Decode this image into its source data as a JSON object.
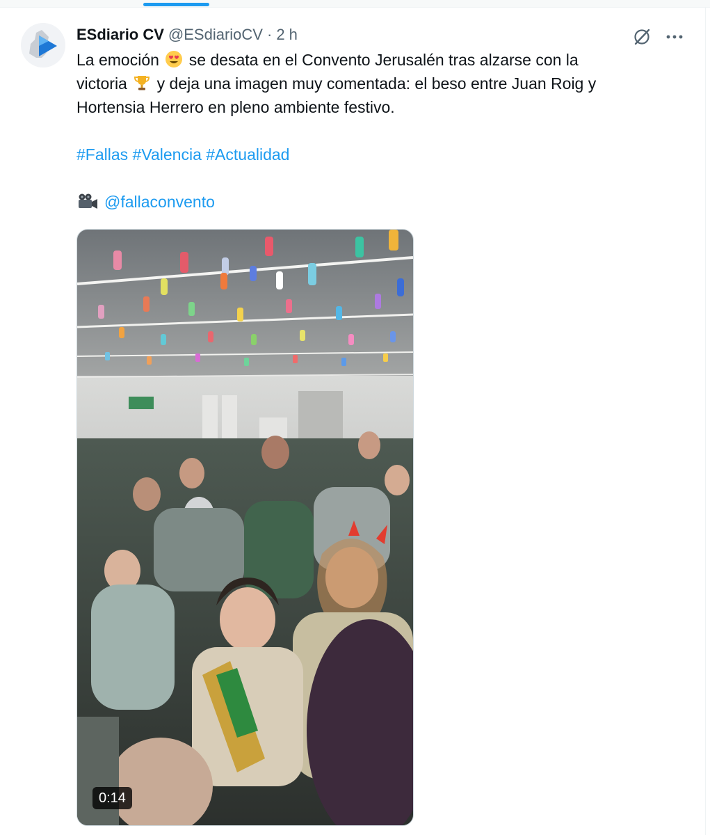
{
  "tweet": {
    "author": {
      "name": "ESdiario CV",
      "handle": "@ESdiarioCV",
      "separator": "·",
      "time": "2 h"
    },
    "text": {
      "line1_part1": "La emoción",
      "line1_part2": "se desata en el Convento Jerusalén tras alzarse con la",
      "line2_part1": "victoria",
      "line2_part2": "y deja una imagen muy comentada: el beso entre Juan Roig y",
      "line3": "Hortensia Herrero en pleno ambiente festivo."
    },
    "hashtags": [
      "#Fallas",
      "#Valencia",
      "#Actualidad"
    ],
    "mention": "@fallaconvento",
    "emojis": [
      "heart-eyes-emoji",
      "trophy-emoji",
      "video-camera-emoji"
    ],
    "video": {
      "duration": "0:14"
    }
  },
  "colors": {
    "link": "#1d9bf0",
    "text": "#0f1419",
    "secondary": "#536471"
  }
}
